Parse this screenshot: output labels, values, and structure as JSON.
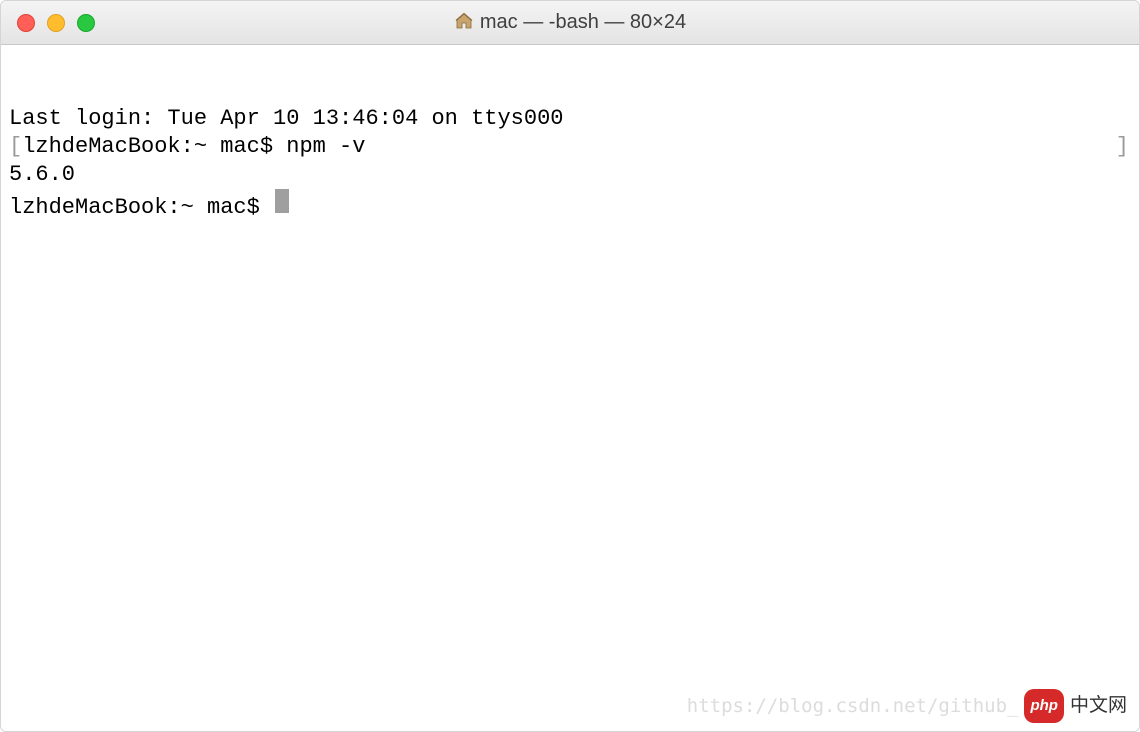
{
  "window": {
    "title": "mac — -bash — 80×24"
  },
  "terminal": {
    "last_login": "Last login: Tue Apr 10 13:46:04 on ttys000",
    "bracket_open": "[",
    "bracket_close": "]",
    "prompt1_host": "lzhdeMacBook:~ mac$ ",
    "command1": "npm -v",
    "output1": "5.6.0",
    "prompt2_host": "lzhdeMacBook:~ mac$ "
  },
  "watermark": {
    "url": "https://blog.csdn.net/github_",
    "badge": "php",
    "cn": "中文网"
  }
}
